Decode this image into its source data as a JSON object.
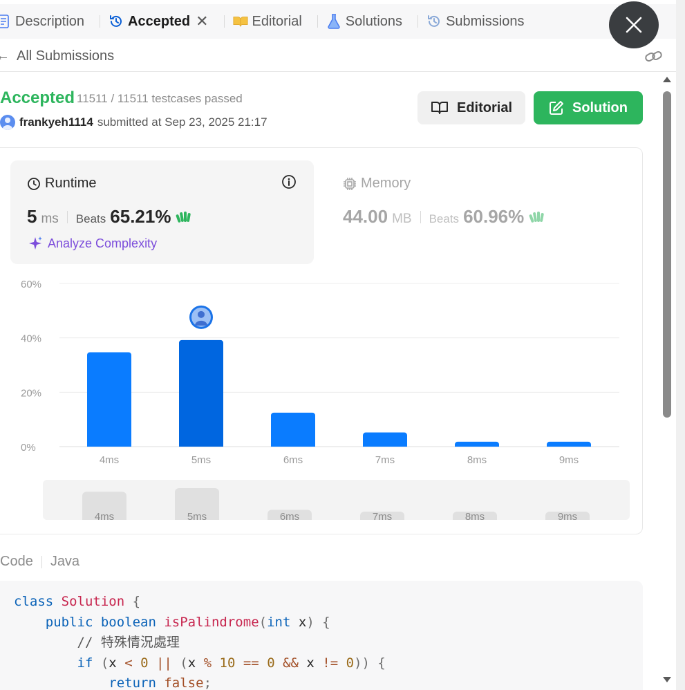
{
  "tabs": [
    {
      "label": "Description",
      "icon": "document-icon"
    },
    {
      "label": "Accepted",
      "icon": "history-icon",
      "active": true,
      "closable": true
    },
    {
      "label": "Editorial",
      "icon": "book-icon"
    },
    {
      "label": "Solutions",
      "icon": "flask-icon"
    },
    {
      "label": "Submissions",
      "icon": "history-icon"
    }
  ],
  "back": {
    "label": "All Submissions"
  },
  "submission": {
    "status": "Accepted",
    "testcases": "11511 / 11511 testcases passed",
    "username": "frankyeh1114",
    "submitted_text": "submitted at Sep 23, 2025 21:17"
  },
  "buttons": {
    "editorial": "Editorial",
    "solution": "Solution"
  },
  "runtime": {
    "label": "Runtime",
    "value": "5",
    "unit": "ms",
    "beats_label": "Beats",
    "beats_value": "65.21%",
    "analyze_label": "Analyze Complexity"
  },
  "memory": {
    "label": "Memory",
    "value": "44.00",
    "unit": "MB",
    "beats_label": "Beats",
    "beats_value": "60.96%"
  },
  "colors": {
    "accent_green": "#2db55d",
    "bar_blue": "#0a7cff",
    "bar_highlight": "#0066e0",
    "analyze_purple": "#7c4ddb"
  },
  "chart_data": {
    "type": "bar",
    "categories": [
      "4ms",
      "5ms",
      "6ms",
      "7ms",
      "8ms",
      "9ms"
    ],
    "values": [
      34.7,
      39.2,
      12.5,
      5.2,
      1.8,
      1.8
    ],
    "highlight": "5ms",
    "ylim": [
      0,
      60
    ],
    "yticks": [
      0,
      20,
      40,
      60
    ],
    "ytick_labels": [
      "0%",
      "20%",
      "40%",
      "60%"
    ],
    "grid": true,
    "navigator": {
      "categories": [
        "4ms",
        "5ms",
        "6ms",
        "7ms",
        "8ms",
        "9ms"
      ]
    }
  },
  "code": {
    "label": "Code",
    "language": "Java",
    "lines": [
      [
        [
          "kw",
          "class "
        ],
        [
          "cls",
          "Solution"
        ],
        [
          "pn",
          " {"
        ]
      ],
      [
        [
          "t",
          "    "
        ],
        [
          "kw",
          "public boolean "
        ],
        [
          "fn",
          "isPalindrome"
        ],
        [
          "pn",
          "("
        ],
        [
          "kw",
          "int "
        ],
        [
          "t",
          "x"
        ],
        [
          "pn",
          ") {"
        ]
      ],
      [
        [
          "t",
          "        "
        ],
        [
          "cm",
          "// 特殊情況處理"
        ]
      ],
      [
        [
          "t",
          "        "
        ],
        [
          "kw",
          "if "
        ],
        [
          "pn",
          "("
        ],
        [
          "t",
          "x "
        ],
        [
          "op",
          "< "
        ],
        [
          "num",
          "0 "
        ],
        [
          "op",
          "|| "
        ],
        [
          "pn",
          "("
        ],
        [
          "t",
          "x "
        ],
        [
          "op",
          "% "
        ],
        [
          "num",
          "10 "
        ],
        [
          "op",
          "== "
        ],
        [
          "num",
          "0 "
        ],
        [
          "op",
          "&& "
        ],
        [
          "t",
          "x "
        ],
        [
          "op",
          "!= "
        ],
        [
          "num",
          "0"
        ],
        [
          "pn",
          ")) {"
        ]
      ],
      [
        [
          "t",
          "            "
        ],
        [
          "kw",
          "return "
        ],
        [
          "op",
          "false"
        ],
        [
          "pn",
          ";"
        ]
      ]
    ]
  }
}
